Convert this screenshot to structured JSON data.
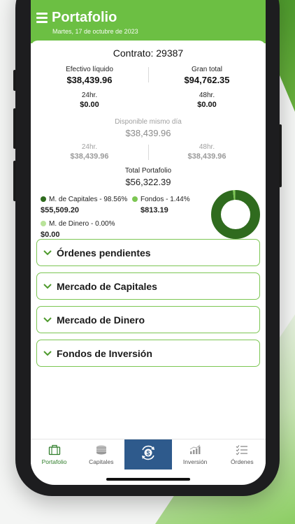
{
  "header": {
    "title": "Portafolio",
    "date": "Martes, 17 de octubre de 2023"
  },
  "contract": {
    "label": "Contrato:",
    "number": "29387"
  },
  "summary": {
    "efectivo_label": "Efectivo líquido",
    "efectivo_value": "$38,439.96",
    "gran_total_label": "Gran total",
    "gran_total_value": "$94,762.35",
    "h24_label": "24hr.",
    "h24_value": "$0.00",
    "h48_label": "48hr.",
    "h48_value": "$0.00"
  },
  "disponible": {
    "label": "Disponible mismo día",
    "value": "$38,439.96",
    "h24_label": "24hr.",
    "h24_value": "$38,439.96",
    "h48_label": "48hr.",
    "h48_value": "$38,439.96"
  },
  "total_portafolio": {
    "label": "Total Portafolio",
    "value": "$56,322.39"
  },
  "legend": [
    {
      "label": "M. de Capitales - 98.56%",
      "amount": "$55,509.20",
      "color": "#2f6b1e"
    },
    {
      "label": "Fondos - 1.44%",
      "amount": "$813.19",
      "color": "#7cc653"
    },
    {
      "label": "M. de Dinero - 0.00%",
      "amount": "$0.00",
      "color": "#b9e39a"
    }
  ],
  "chart_data": {
    "type": "pie",
    "categories": [
      "M. de Capitales",
      "Fondos",
      "M. de Dinero"
    ],
    "values": [
      98.56,
      1.44,
      0.0
    ],
    "colors": [
      "#2f6b1e",
      "#7cc653",
      "#b9e39a"
    ]
  },
  "accordions": [
    {
      "label": "Órdenes pendientes"
    },
    {
      "label": "Mercado de Capitales"
    },
    {
      "label": "Mercado de Dinero"
    },
    {
      "label": "Fondos de Inversión"
    }
  ],
  "tabs": [
    {
      "label": "Portafolio",
      "icon": "briefcase-icon"
    },
    {
      "label": "Capitales",
      "icon": "coins-icon"
    },
    {
      "label": "",
      "icon": "dollar-exchange-icon"
    },
    {
      "label": "Inversión",
      "icon": "bar-chart-icon"
    },
    {
      "label": "Órdenes",
      "icon": "checklist-icon"
    }
  ],
  "colors": {
    "brand_green": "#6cbf43",
    "accent_blue": "#2e5a8c"
  }
}
